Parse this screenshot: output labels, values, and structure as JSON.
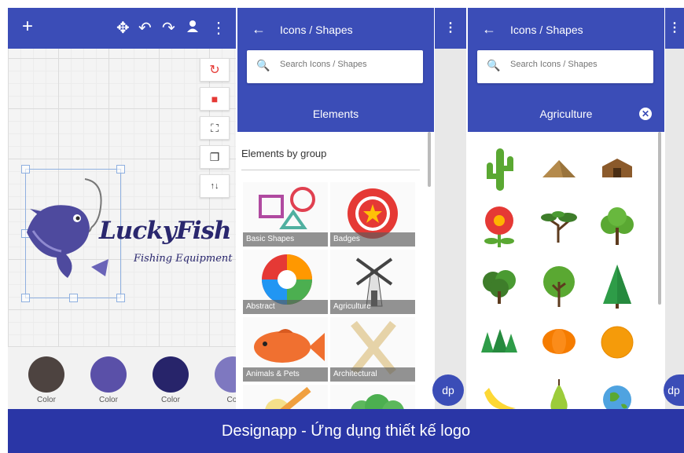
{
  "editor": {
    "toolbar": {
      "add_icon": "+",
      "move_icon": "✥",
      "undo_icon": "↶",
      "redo_icon": "↷",
      "person_icon": "👤",
      "more_icon": "⋮"
    },
    "tools": [
      "refresh-icon",
      "delete-icon",
      "fit-icon",
      "copy-icon",
      "swap-icon"
    ],
    "logo": {
      "brand": "LuckyFish",
      "tagline": "Fishing Equipment"
    },
    "colors": [
      {
        "hex": "#4d4340",
        "label": "Color"
      },
      {
        "hex": "#5a50a8",
        "label": "Color"
      },
      {
        "hex": "#27246a",
        "label": "Color"
      },
      {
        "hex": "#7e78c0",
        "label": "Col"
      }
    ]
  },
  "elements_panel": {
    "title": "Icons / Shapes",
    "search_placeholder": "Search Icons / Shapes",
    "section_title": "Elements",
    "group_heading": "Elements by group",
    "tiles": [
      "Basic Shapes",
      "Badges",
      "Abstract",
      "Agriculture",
      "Animals & Pets",
      "Architectural"
    ]
  },
  "agriculture_panel": {
    "title": "Icons / Shapes",
    "search_placeholder": "Search Icons / Shapes",
    "section_title": "Agriculture",
    "icons": [
      "cactus-icon",
      "mound-icon",
      "barn-icon",
      "flower-icon",
      "acacia-tree-icon",
      "round-tree-icon",
      "bush-tree-icon",
      "tree-icon",
      "pine-tree-icon",
      "pine-group-icon",
      "pumpkin-icon",
      "orange-icon",
      "banana-icon",
      "pear-icon",
      "globe-icon"
    ]
  },
  "banner": {
    "text": "Designapp - Ứng dụng thiết kế logo"
  },
  "colors": {
    "primary": "#3b4db7",
    "banner": "#2a36a6"
  }
}
